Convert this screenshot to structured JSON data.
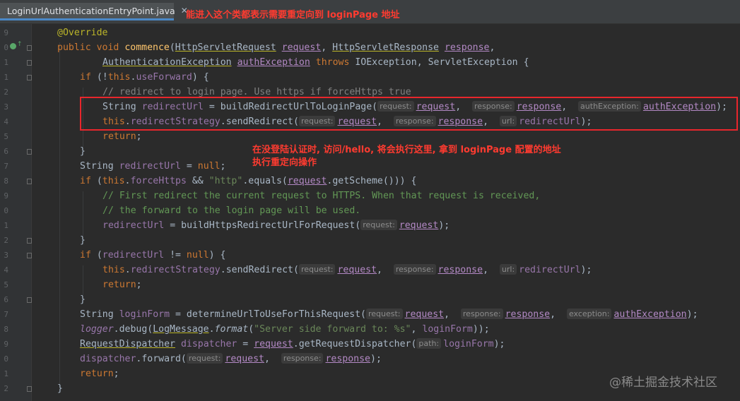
{
  "tab": {
    "title": "LoginUrlAuthenticationEntryPoint.java",
    "close": "✕"
  },
  "annotations": {
    "top": "能进入这个类都表示需要重定向到 loginPage 地址",
    "mid_line1": "在没登陆认证时, 访问/hello, 将会执行这里, 拿到 loginPage 配置的地址",
    "mid_line2": "执行重定向操作"
  },
  "watermark": "@稀土掘金技术社区",
  "line_numbers": [
    "9",
    "0",
    "1",
    "1",
    "2",
    "3",
    "4",
    "5",
    "6",
    "7",
    "8",
    "9",
    "0",
    "1",
    "2",
    "3",
    "4",
    "5",
    "6",
    "7",
    "8",
    "9",
    "0",
    "1",
    "2"
  ],
  "code": {
    "l1": {
      "override": "@Override"
    },
    "l2": {
      "public": "public",
      "void": "void",
      "method": "commence",
      "type1": "HttpServletRequest",
      "p1": "request",
      "type2": "HttpServletResponse",
      "p2": "response"
    },
    "l3": {
      "type": "AuthenticationException",
      "p": "authException",
      "throws": "throws",
      "ex1": "IOException",
      "ex2": "ServletException"
    },
    "l4": {
      "if": "if",
      "this": "this",
      "field": "useForward"
    },
    "l5": {
      "comment": "// redirect to login page. Use https if forceHttps true"
    },
    "l6": {
      "type": "String",
      "var": "redirectUrl",
      "call": "buildRedirectUrlToLoginPage(",
      "h1": "request:",
      "a1": "request",
      "h2": "response:",
      "a2": "response",
      "h3": "authException:",
      "a3": "authException"
    },
    "l7": {
      "this": "this",
      "field": "redirectStrategy",
      "call": "sendRedirect(",
      "h1": "request:",
      "a1": "request",
      "h2": "response:",
      "a2": "response",
      "h3": "url:",
      "a3": "redirectUrl"
    },
    "l8": {
      "ret": "return"
    },
    "l9": {
      "brace": "}"
    },
    "l10": {
      "type": "String",
      "var": "redirectUrl",
      "null": "null"
    },
    "l11": {
      "if": "if",
      "this": "this",
      "field": "forceHttps",
      "str": "\"http\"",
      "equals": "equals(",
      "p": "request",
      "rest": ".getScheme())) {"
    },
    "l12": {
      "comment": "// First redirect the current request to HTTPS. When that request is received,"
    },
    "l13": {
      "comment": "// the forward to the login page will be used."
    },
    "l14": {
      "var": "redirectUrl",
      "call": "buildHttpsRedirectUrlForRequest(",
      "h1": "request:",
      "a1": "request"
    },
    "l15": {
      "brace": "}"
    },
    "l16": {
      "if": "if",
      "var": "redirectUrl",
      "null": "null"
    },
    "l17": {
      "this": "this",
      "field": "redirectStrategy",
      "call": "sendRedirect(",
      "h1": "request:",
      "a1": "request",
      "h2": "response:",
      "a2": "response",
      "h3": "url:",
      "a3": "redirectUrl"
    },
    "l18": {
      "ret": "return"
    },
    "l19": {
      "brace": "}"
    },
    "l20": {
      "type": "String",
      "var": "loginForm",
      "call": "determineUrlToUseForThisRequest(",
      "h1": "request:",
      "a1": "request",
      "h2": "response:",
      "a2": "response",
      "h3": "exception:",
      "a3": "authException"
    },
    "l21": {
      "logger": "logger",
      "debug": ".debug(",
      "lm": "LogMessage",
      "format": "format",
      "str": "\"Server side forward to: %s\"",
      "var": "loginForm"
    },
    "l22": {
      "type": "RequestDispatcher",
      "var": "dispatcher",
      "p": "request",
      "call": ".getRequestDispatcher(",
      "h1": "path:",
      "a1": "loginForm"
    },
    "l23": {
      "var": "dispatcher",
      "call": ".forward(",
      "h1": "request:",
      "a1": "request",
      "h2": "response:",
      "a2": "response"
    },
    "l24": {
      "ret": "return"
    },
    "l25": {
      "brace": "}"
    }
  },
  "colors": {
    "accent": "#ff3b30",
    "box": "#e8262c",
    "background": "#2b2b2b"
  }
}
